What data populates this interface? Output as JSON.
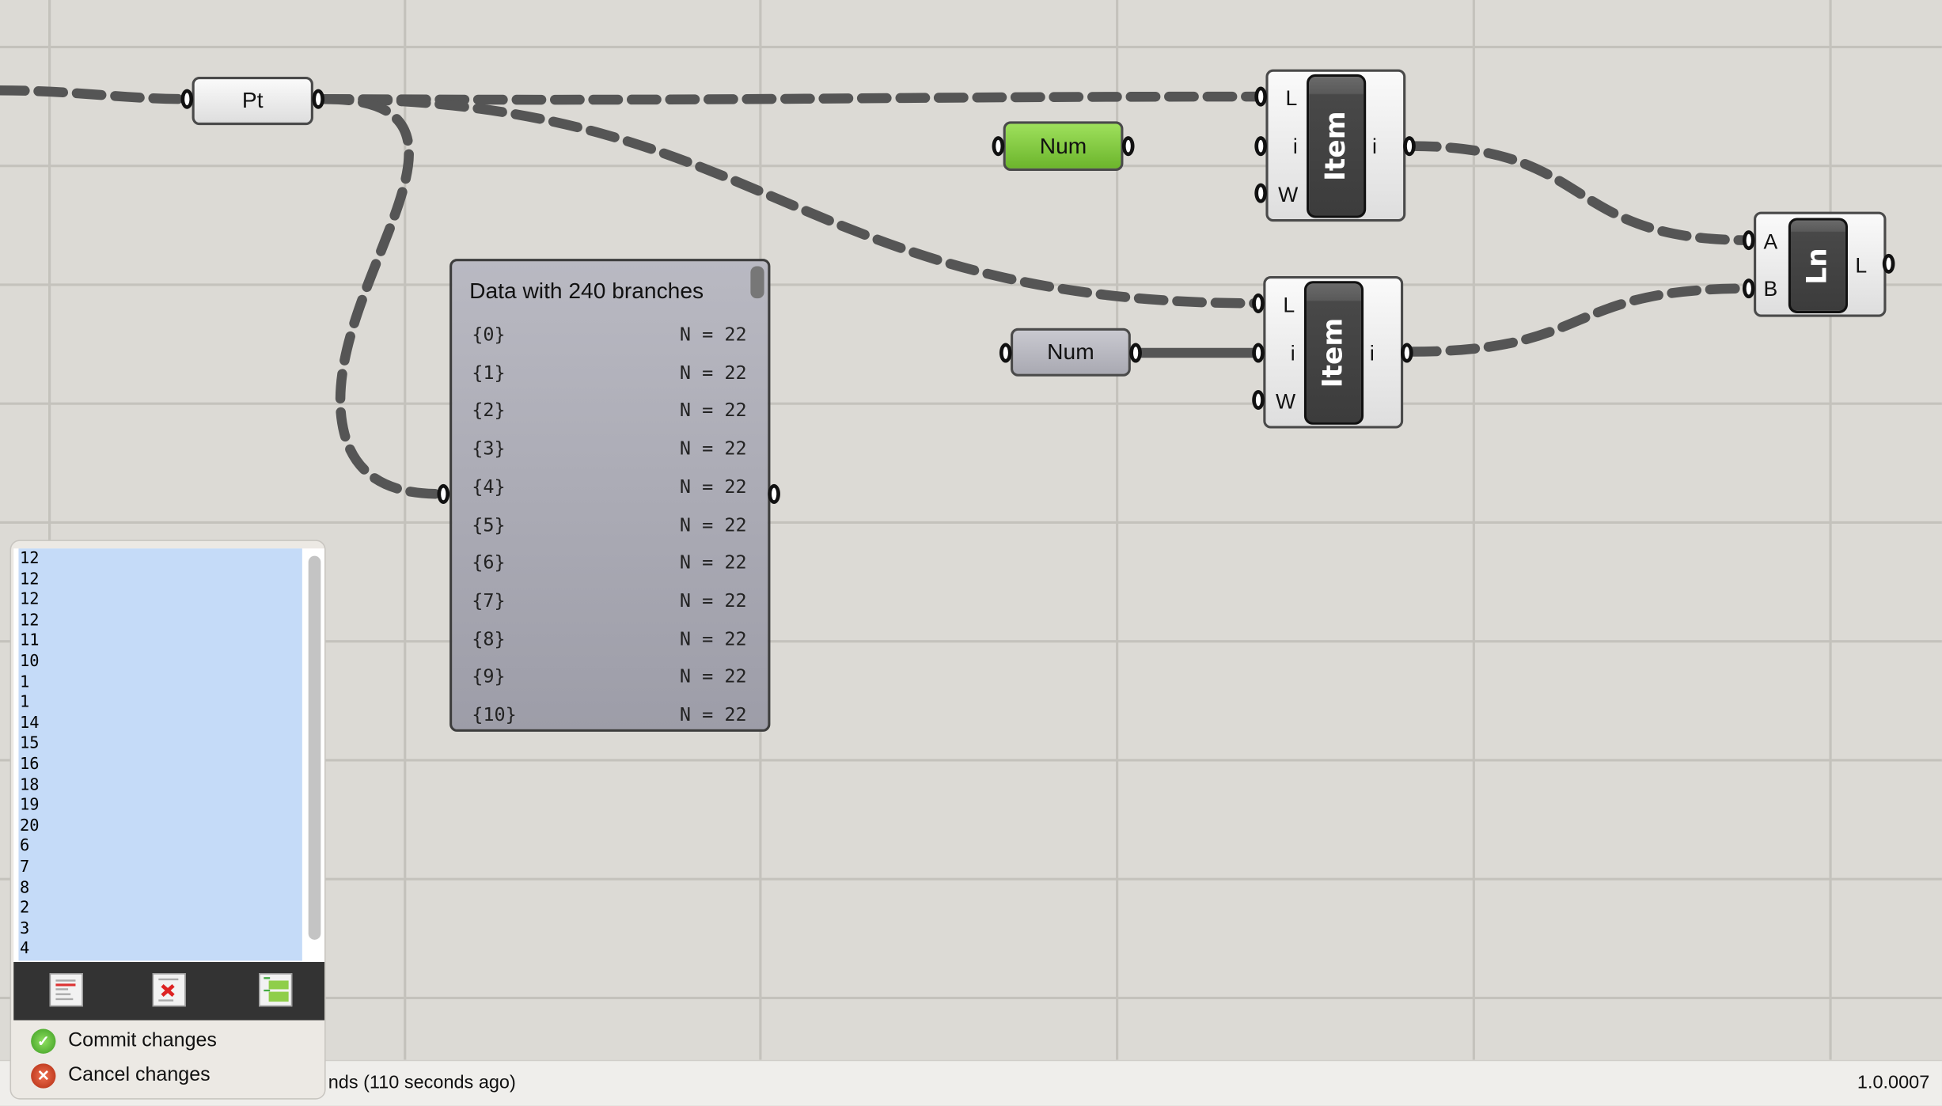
{
  "canvas": {
    "colors": {
      "background": "#dcdad5",
      "grid": "#c4c2bc",
      "wire": "#555555",
      "num_green": "#7cc13a",
      "selection": "#c5dbf8"
    }
  },
  "components": {
    "point_param": {
      "label": "Pt"
    },
    "number_green": {
      "label": "Num"
    },
    "number_grey": {
      "label": "Num"
    },
    "list_item_1": {
      "label": "Item",
      "inputs": [
        "L",
        "i",
        "W"
      ],
      "outputs": [
        "i"
      ]
    },
    "list_item_2": {
      "label": "Item",
      "inputs": [
        "L",
        "i",
        "W"
      ],
      "outputs": [
        "i"
      ]
    },
    "line": {
      "label": "Ln",
      "inputs": [
        "A",
        "B"
      ],
      "outputs": [
        "L"
      ]
    }
  },
  "panel": {
    "title": "Data with 240 branches",
    "rows": [
      {
        "path": "{0}",
        "count": "N = 22"
      },
      {
        "path": "{1}",
        "count": "N = 22"
      },
      {
        "path": "{2}",
        "count": "N = 22"
      },
      {
        "path": "{3}",
        "count": "N = 22"
      },
      {
        "path": "{4}",
        "count": "N = 22"
      },
      {
        "path": "{5}",
        "count": "N = 22"
      },
      {
        "path": "{6}",
        "count": "N = 22"
      },
      {
        "path": "{7}",
        "count": "N = 22"
      },
      {
        "path": "{8}",
        "count": "N = 22"
      },
      {
        "path": "{9}",
        "count": "N = 22"
      },
      {
        "path": "{10}",
        "count": "N = 22"
      }
    ]
  },
  "editor": {
    "values": [
      "12",
      "12",
      "12",
      "12",
      "11",
      "10",
      "1",
      "1",
      "14",
      "15",
      "16",
      "18",
      "19",
      "20",
      "6",
      "7",
      "8",
      "2",
      "3",
      "4"
    ],
    "toolbar": [
      "clear-list-icon",
      "delete-item-icon",
      "add-items-icon"
    ],
    "commit_label": "Commit changes",
    "cancel_label": "Cancel changes"
  },
  "status": {
    "message": "nds (110 seconds ago)",
    "version": "1.0.0007"
  }
}
